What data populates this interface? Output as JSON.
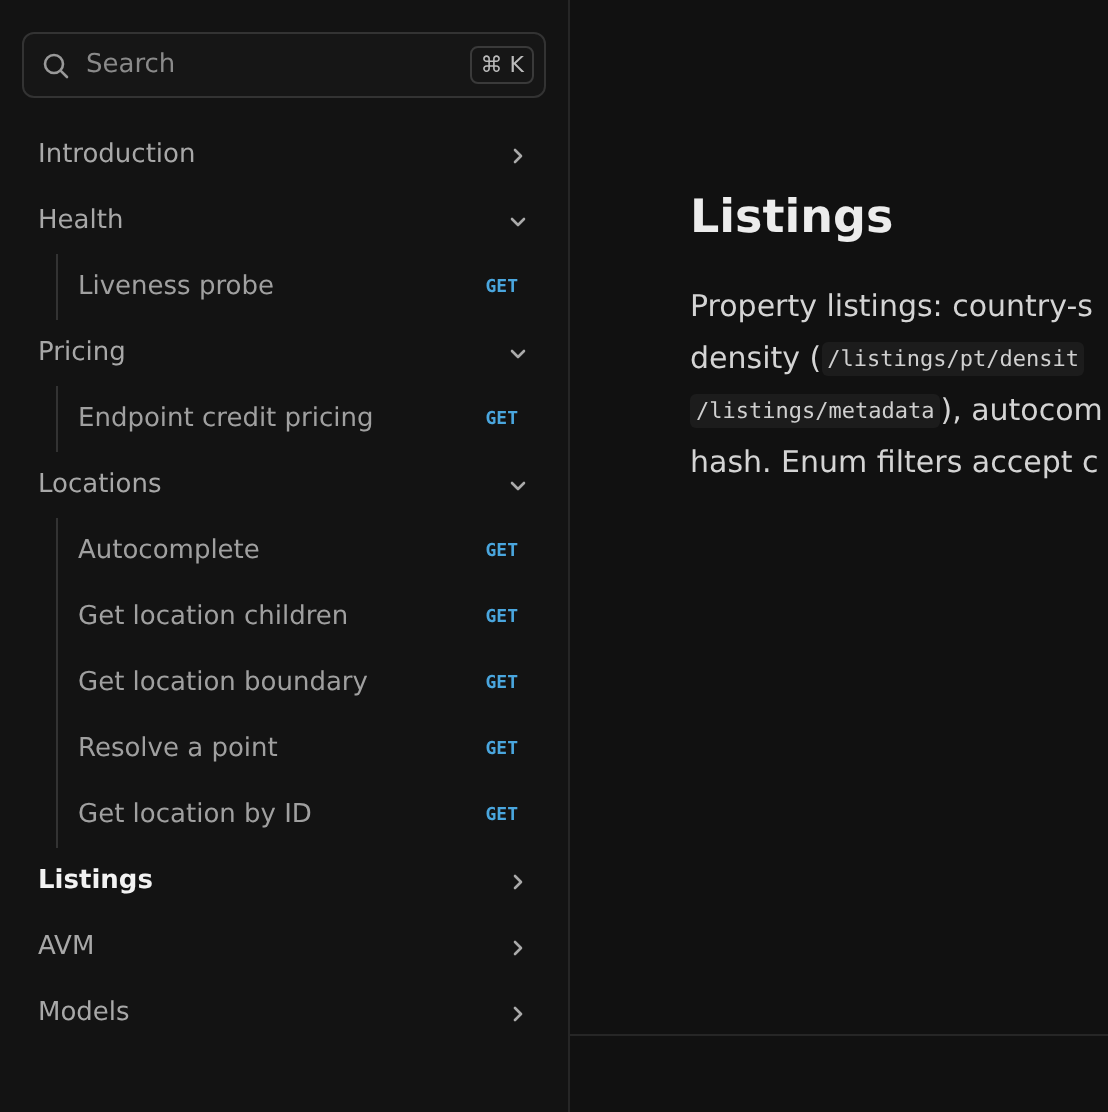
{
  "search": {
    "placeholder": "Search",
    "shortcut": "⌘ K"
  },
  "nav": [
    {
      "label": "Introduction",
      "expanded": false,
      "selected": false
    },
    {
      "label": "Health",
      "expanded": true,
      "selected": false,
      "children": [
        {
          "label": "Liveness probe",
          "method": "GET"
        }
      ]
    },
    {
      "label": "Pricing",
      "expanded": true,
      "selected": false,
      "children": [
        {
          "label": "Endpoint credit pricing",
          "method": "GET"
        }
      ]
    },
    {
      "label": "Locations",
      "expanded": true,
      "selected": false,
      "children": [
        {
          "label": "Autocomplete",
          "method": "GET"
        },
        {
          "label": "Get location children",
          "method": "GET"
        },
        {
          "label": "Get location boundary",
          "method": "GET"
        },
        {
          "label": "Resolve a point",
          "method": "GET"
        },
        {
          "label": "Get location by ID",
          "method": "GET"
        }
      ]
    },
    {
      "label": "Listings",
      "expanded": false,
      "selected": true
    },
    {
      "label": "AVM",
      "expanded": false,
      "selected": false
    },
    {
      "label": "Models",
      "expanded": false,
      "selected": false
    }
  ],
  "content": {
    "title": "Listings",
    "lines": [
      [
        {
          "kind": "text",
          "text": "Property listings: country-s"
        }
      ],
      [
        {
          "kind": "text",
          "text": "density ("
        },
        {
          "kind": "code",
          "text": "/listings/pt/densit"
        }
      ],
      [
        {
          "kind": "code",
          "text": "/listings/metadata"
        },
        {
          "kind": "text",
          "text": "), autocom"
        }
      ],
      [
        {
          "kind": "text",
          "text": "hash. Enum filters accept c"
        }
      ]
    ]
  }
}
